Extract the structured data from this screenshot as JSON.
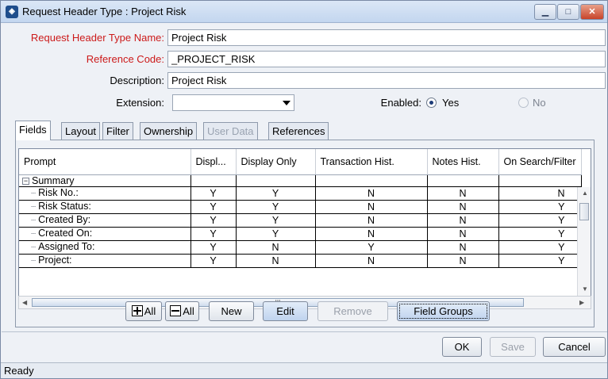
{
  "window": {
    "title": "Request Header Type : Project Risk",
    "minimize": "▁",
    "maximize": "□",
    "close": "✕"
  },
  "form": {
    "name_label": "Request Header Type Name:",
    "name_value": "Project Risk",
    "ref_label": "Reference Code:",
    "ref_value": "_PROJECT_RISK",
    "desc_label": "Description:",
    "desc_value": "Project Risk",
    "ext_label": "Extension:",
    "ext_value": "",
    "enabled_label": "Enabled:",
    "yes_label": "Yes",
    "no_label": "No",
    "enabled_selected": "Yes"
  },
  "tabs": [
    {
      "label": "Fields",
      "active": true
    },
    {
      "label": "Layout"
    },
    {
      "label": "Filter"
    },
    {
      "label": "Ownership"
    },
    {
      "label": "User Data",
      "disabled": true
    },
    {
      "label": "References"
    }
  ],
  "table": {
    "columns": [
      "Prompt",
      "Displ...",
      "Display Only",
      "Transaction Hist.",
      "Notes Hist.",
      "On Search/Filter"
    ],
    "group": "Summary",
    "rows": [
      {
        "prompt": "Risk No.:",
        "c1": "Y",
        "c2": "Y",
        "c3": "N",
        "c4": "N",
        "c5": "N"
      },
      {
        "prompt": "Risk Status:",
        "c1": "Y",
        "c2": "Y",
        "c3": "N",
        "c4": "N",
        "c5": "Y"
      },
      {
        "prompt": "Created By:",
        "c1": "Y",
        "c2": "Y",
        "c3": "N",
        "c4": "N",
        "c5": "Y"
      },
      {
        "prompt": "Created On:",
        "c1": "Y",
        "c2": "Y",
        "c3": "N",
        "c4": "N",
        "c5": "Y"
      },
      {
        "prompt": "Assigned To:",
        "c1": "Y",
        "c2": "N",
        "c3": "Y",
        "c4": "N",
        "c5": "Y"
      },
      {
        "prompt": "Project:",
        "c1": "Y",
        "c2": "N",
        "c3": "N",
        "c4": "N",
        "c5": "Y"
      }
    ],
    "hscroll_grip": "III"
  },
  "buttons": {
    "expand_all": "All",
    "collapse_all": "All",
    "new": "New",
    "edit": "Edit",
    "remove": "Remove",
    "field_groups": "Field Groups",
    "ok": "OK",
    "save": "Save",
    "cancel": "Cancel"
  },
  "status": "Ready"
}
